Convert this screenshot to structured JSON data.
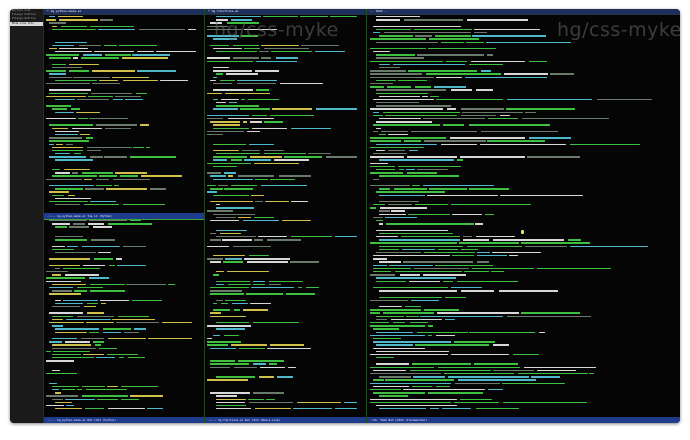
{
  "window": {
    "title": ""
  },
  "sidebar": {
    "items": [
      {
        "label": "Buffers List"
      },
      {
        "label": "Filesys Outline"
      },
      {
        "label": "Filesys Outline"
      },
      {
        "label": "Mode-Line Info"
      }
    ],
    "selected_index": 3
  },
  "editor_left": {
    "tab_label": "* hg-python-mode.el",
    "status_top": "-:--- hg-python-mode.el   Top L1   (Python)",
    "status_bottom": "-:--- hg-python-mode.el   Bot L321   (Python)"
  },
  "editor_mid": {
    "tab_label": "* hg-functions.el",
    "watermark": "hg/css-myke",
    "status_bottom": "-:--- hg-functions.el   Bot L214   (Emacs-Lisp)"
  },
  "editor_right": {
    "tab_label": "-- TAGS --",
    "watermark": "hg/css-myke",
    "status_bottom": "-:%%- TAGS   Bot L1024   (Fundamental)"
  },
  "colors": {
    "text_green": "#3fbf3f",
    "text_white": "#d8d8d8",
    "keyword_yellow": "#cfc04a",
    "comment_gray": "#6b7b6b",
    "string_cyan": "#4fb9c9",
    "modeline_blue": "#1f3c8c",
    "cursor": "#e8e060"
  }
}
